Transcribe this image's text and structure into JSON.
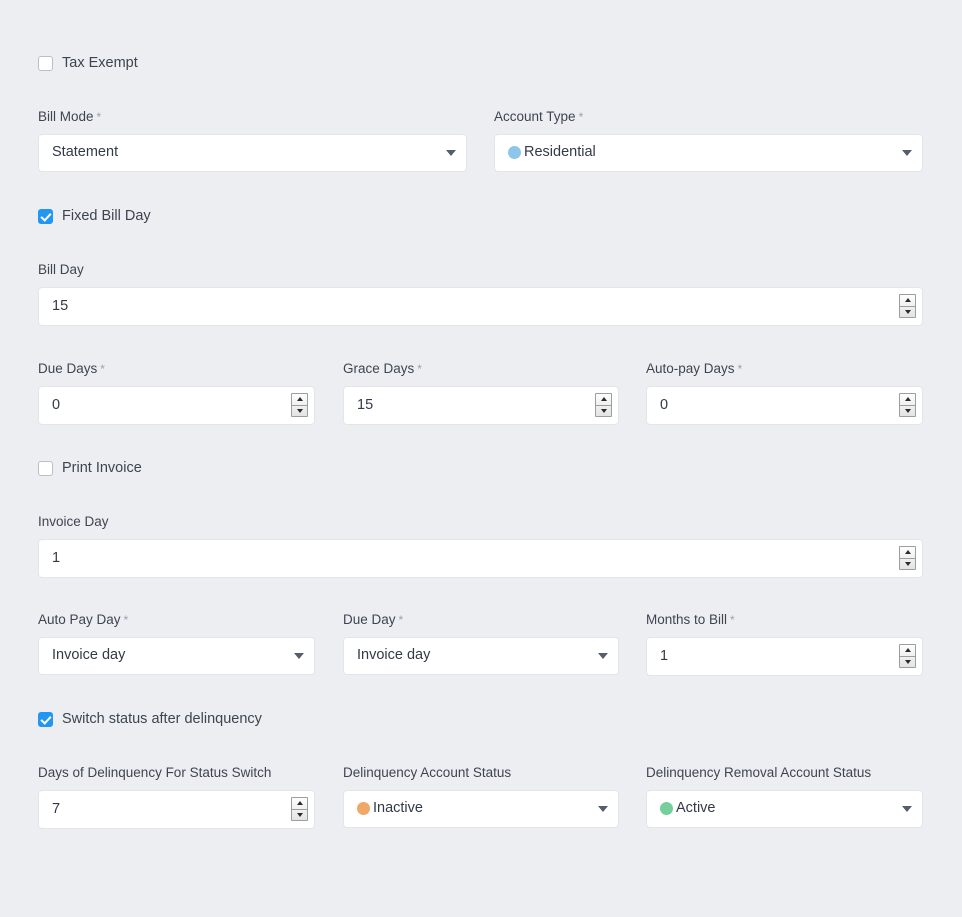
{
  "colors": {
    "page_background": "#edeef1",
    "checkbox_checked": "#2196f3",
    "field_background": "#ffffff",
    "field_border": "#e3e5ea",
    "label_text": "#3d4552",
    "required_asterisk": "#9aa1ad",
    "dot_residential": "#8dc6ea",
    "dot_inactive": "#f0a868",
    "dot_active": "#76ce9c"
  },
  "form": {
    "tax_exempt": {
      "label": "Tax Exempt",
      "checked": false
    },
    "bill_mode": {
      "label": "Bill Mode",
      "required": true,
      "required_mark": "*",
      "value": "Statement",
      "type": "select",
      "caret_icon": "chevron-down-icon"
    },
    "account_type": {
      "label": "Account Type",
      "required": true,
      "required_mark": "*",
      "value": "Residential",
      "type": "select",
      "dot_color": "#8dc6ea",
      "dot_icon": "status-dot-icon",
      "caret_icon": "chevron-down-icon"
    },
    "fixed_bill_day": {
      "label": "Fixed Bill Day",
      "checked": true
    },
    "bill_day": {
      "label": "Bill Day",
      "required": false,
      "value": "15",
      "type": "number",
      "spinner_icon": "number-stepper-icon"
    },
    "due_days": {
      "label": "Due Days",
      "required": true,
      "required_mark": "*",
      "value": "0",
      "type": "number",
      "spinner_icon": "number-stepper-icon"
    },
    "grace_days": {
      "label": "Grace Days",
      "required": true,
      "required_mark": "*",
      "value": "15",
      "type": "number",
      "spinner_icon": "number-stepper-icon"
    },
    "auto_pay_days": {
      "label": "Auto-pay Days",
      "required": true,
      "required_mark": "*",
      "value": "0",
      "type": "number",
      "spinner_icon": "number-stepper-icon"
    },
    "print_invoice": {
      "label": "Print Invoice",
      "checked": false
    },
    "invoice_day": {
      "label": "Invoice Day",
      "required": false,
      "value": "1",
      "type": "number",
      "spinner_icon": "number-stepper-icon"
    },
    "auto_pay_day": {
      "label": "Auto Pay Day",
      "required": true,
      "required_mark": "*",
      "value": "Invoice day",
      "type": "select",
      "caret_icon": "chevron-down-icon"
    },
    "due_day": {
      "label": "Due Day",
      "required": true,
      "required_mark": "*",
      "value": "Invoice day",
      "type": "select",
      "caret_icon": "chevron-down-icon"
    },
    "months_to_bill": {
      "label": "Months to Bill",
      "required": true,
      "required_mark": "*",
      "value": "1",
      "type": "number",
      "spinner_icon": "number-stepper-icon"
    },
    "switch_status_after_delinquency": {
      "label": "Switch status after delinquency",
      "checked": true
    },
    "days_of_delinquency": {
      "label": "Days of Delinquency For Status Switch",
      "required": false,
      "value": "7",
      "type": "number",
      "spinner_icon": "number-stepper-icon"
    },
    "delinquency_account_status": {
      "label": "Delinquency Account Status",
      "required": false,
      "value": "Inactive",
      "type": "select",
      "dot_color": "#f0a868",
      "dot_icon": "status-dot-icon",
      "caret_icon": "chevron-down-icon"
    },
    "delinquency_removal_account_status": {
      "label": "Delinquency Removal Account Status",
      "required": false,
      "value": "Active",
      "type": "select",
      "dot_color": "#76ce9c",
      "dot_icon": "status-dot-icon",
      "caret_icon": "chevron-down-icon"
    }
  }
}
